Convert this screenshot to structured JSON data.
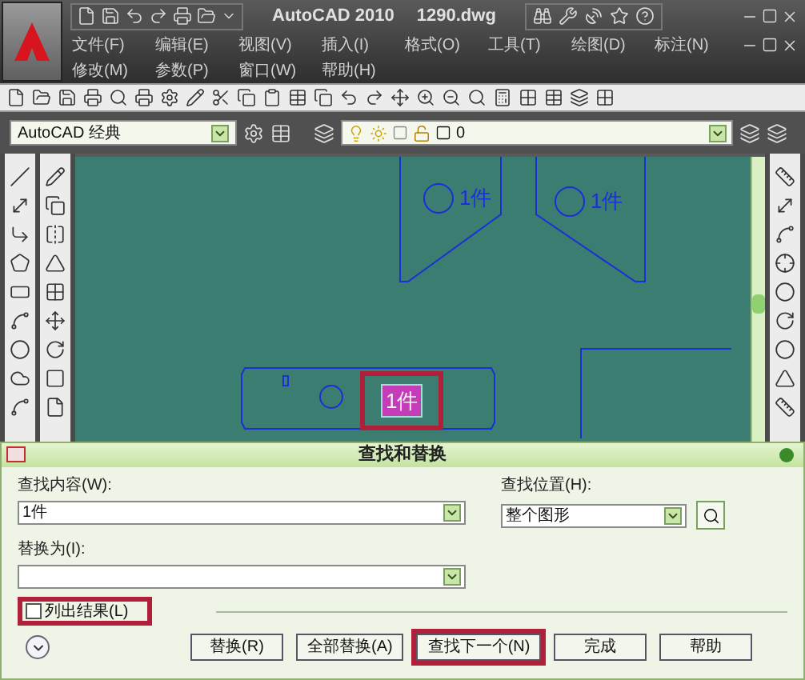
{
  "title_bar": {
    "app": "AutoCAD 2010",
    "file": "1290.dwg"
  },
  "menu_rows": [
    [
      "文件(F)",
      "编辑(E)",
      "视图(V)",
      "插入(I)",
      "格式(O)",
      "工具(T)",
      "绘图(D)",
      "标注(N)"
    ],
    [
      "修改(M)",
      "参数(P)",
      "窗口(W)",
      "帮助(H)"
    ]
  ],
  "workspace": {
    "value": "AutoCAD 经典"
  },
  "layer": {
    "value": "0"
  },
  "canvas": {
    "labels": [
      {
        "text": "1件",
        "highlighted": false
      },
      {
        "text": "1件",
        "highlighted": false
      },
      {
        "text": "1件",
        "highlighted": true
      }
    ]
  },
  "dialog": {
    "title": "查找和替换",
    "find_label": "查找内容(W):",
    "find_value": "1件",
    "location_label": "查找位置(H):",
    "location_value": "整个图形",
    "replace_label": "替换为(I):",
    "list_results": {
      "label": "列出结果(L)",
      "checked": false,
      "highlighted": true
    },
    "buttons": [
      {
        "label": "替换(R)",
        "highlighted": false
      },
      {
        "label": "全部替换(A)",
        "highlighted": false
      },
      {
        "label": "查找下一个(N)",
        "highlighted": true
      },
      {
        "label": "完成",
        "highlighted": false
      },
      {
        "label": "帮助",
        "highlighted": false
      }
    ]
  }
}
